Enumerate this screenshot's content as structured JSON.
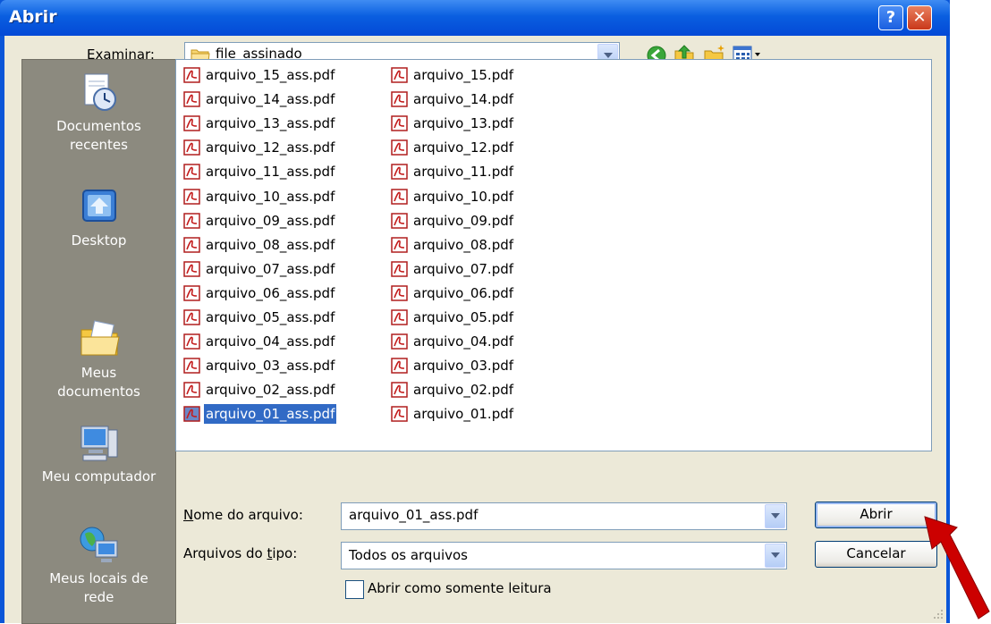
{
  "window": {
    "title": "Abrir",
    "help_label": "?",
    "close_label": "✕"
  },
  "toolbar": {
    "look_in_label": "Examinar:",
    "look_in_value": "file_assinado",
    "icons": [
      "back-icon",
      "up-folder-icon",
      "new-folder-icon",
      "view-menu-icon"
    ]
  },
  "places": [
    {
      "label_line1": "Documentos",
      "label_line2": "recentes",
      "icon": "recent-documents-icon"
    },
    {
      "label_line1": "Desktop",
      "label_line2": "",
      "icon": "desktop-icon"
    },
    {
      "label_line1": "Meus",
      "label_line2": "documentos",
      "icon": "my-documents-icon"
    },
    {
      "label_line1": "Meu computador",
      "label_line2": "",
      "icon": "my-computer-icon"
    },
    {
      "label_line1": "Meus locais de",
      "label_line2": "rede",
      "icon": "network-places-icon"
    }
  ],
  "files": [
    {
      "name": "arquivo_15_ass.pdf",
      "selected": false
    },
    {
      "name": "arquivo_14_ass.pdf",
      "selected": false
    },
    {
      "name": "arquivo_13_ass.pdf",
      "selected": false
    },
    {
      "name": "arquivo_12_ass.pdf",
      "selected": false
    },
    {
      "name": "arquivo_11_ass.pdf",
      "selected": false
    },
    {
      "name": "arquivo_10_ass.pdf",
      "selected": false
    },
    {
      "name": "arquivo_09_ass.pdf",
      "selected": false
    },
    {
      "name": "arquivo_08_ass.pdf",
      "selected": false
    },
    {
      "name": "arquivo_07_ass.pdf",
      "selected": false
    },
    {
      "name": "arquivo_06_ass.pdf",
      "selected": false
    },
    {
      "name": "arquivo_05_ass.pdf",
      "selected": false
    },
    {
      "name": "arquivo_04_ass.pdf",
      "selected": false
    },
    {
      "name": "arquivo_03_ass.pdf",
      "selected": false
    },
    {
      "name": "arquivo_02_ass.pdf",
      "selected": false
    },
    {
      "name": "arquivo_01_ass.pdf",
      "selected": true
    },
    {
      "name": "arquivo_15.pdf",
      "selected": false
    },
    {
      "name": "arquivo_14.pdf",
      "selected": false
    },
    {
      "name": "arquivo_13.pdf",
      "selected": false
    },
    {
      "name": "arquivo_12.pdf",
      "selected": false
    },
    {
      "name": "arquivo_11.pdf",
      "selected": false
    },
    {
      "name": "arquivo_10.pdf",
      "selected": false
    },
    {
      "name": "arquivo_09.pdf",
      "selected": false
    },
    {
      "name": "arquivo_08.pdf",
      "selected": false
    },
    {
      "name": "arquivo_07.pdf",
      "selected": false
    },
    {
      "name": "arquivo_06.pdf",
      "selected": false
    },
    {
      "name": "arquivo_05.pdf",
      "selected": false
    },
    {
      "name": "arquivo_04.pdf",
      "selected": false
    },
    {
      "name": "arquivo_03.pdf",
      "selected": false
    },
    {
      "name": "arquivo_02.pdf",
      "selected": false
    },
    {
      "name": "arquivo_01.pdf",
      "selected": false
    }
  ],
  "form": {
    "filename_label": "Nome do arquivo:",
    "filename_value": "arquivo_01_ass.pdf",
    "filetype_label": "Arquivos do tipo:",
    "filetype_value": "Todos os arquivos",
    "readonly_label": "Abrir como somente leitura",
    "readonly_checked": false
  },
  "buttons": {
    "open_label": "Abrir",
    "cancel_label": "Cancelar"
  },
  "colors": {
    "title_bar": "#0a5fe0",
    "selection": "#316ac5",
    "annotation_arrow": "#cc0000"
  }
}
